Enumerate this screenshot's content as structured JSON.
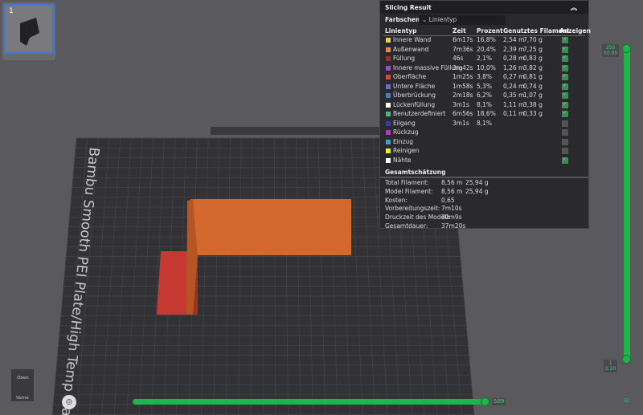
{
  "thumbnail": {
    "index": "1"
  },
  "plate": {
    "label": "Bambu Smooth PEI Plate/High Temp Plate"
  },
  "panel": {
    "title": "Slicing Result",
    "color_scheme_label": "Farbschema",
    "color_scheme_value": "Linientyp",
    "columns": [
      "Linientyp",
      "Zeit",
      "Prozent",
      "Genutztes Filament",
      "Anzeigen"
    ],
    "rows": [
      {
        "name": "Innere Wand",
        "time": "6m17s",
        "pct": "16,8%",
        "len": "2,54 m",
        "wt": "7,70 g",
        "color": "#e8d04a",
        "shown": true
      },
      {
        "name": "Außenwand",
        "time": "7m36s",
        "pct": "20,4%",
        "len": "2,39 m",
        "wt": "7,25 g",
        "color": "#e8894a",
        "shown": true
      },
      {
        "name": "Füllung",
        "time": "46s",
        "pct": "2,1%",
        "len": "0,28 m",
        "wt": "0,83 g",
        "color": "#9a2d2d",
        "shown": true
      },
      {
        "name": "Innere massive Füllung",
        "time": "3m42s",
        "pct": "10,0%",
        "len": "1,26 m",
        "wt": "3,82 g",
        "color": "#9a4ad0",
        "shown": true
      },
      {
        "name": "Oberfläche",
        "time": "1m25s",
        "pct": "3,8%",
        "len": "0,27 m",
        "wt": "0,81 g",
        "color": "#d64a3a",
        "shown": true
      },
      {
        "name": "Untere Fläche",
        "time": "1m58s",
        "pct": "5,3%",
        "len": "0,24 m",
        "wt": "0,74 g",
        "color": "#6a6ad0",
        "shown": true
      },
      {
        "name": "Überbrückung",
        "time": "2m18s",
        "pct": "6,2%",
        "len": "0,35 m",
        "wt": "1,07 g",
        "color": "#4a7ac0",
        "shown": true
      },
      {
        "name": "Lückenfüllung",
        "time": "3m1s",
        "pct": "8,1%",
        "len": "1,11 m",
        "wt": "3,38 g",
        "color": "#ffffff",
        "shown": true
      },
      {
        "name": "Benutzerdefiniert",
        "time": "6m56s",
        "pct": "18,6%",
        "len": "0,11 m",
        "wt": "0,33 g",
        "color": "#4ab87a",
        "shown": true
      },
      {
        "name": "Eilgang",
        "time": "3m1s",
        "pct": "8,1%",
        "len": "",
        "wt": "",
        "color": "#3a3ab0",
        "shown": false
      },
      {
        "name": "Rückzug",
        "time": "",
        "pct": "",
        "len": "",
        "wt": "",
        "color": "#c030c0",
        "shown": false
      },
      {
        "name": "Einzug",
        "time": "",
        "pct": "",
        "len": "",
        "wt": "",
        "color": "#3aa0d0",
        "shown": false
      },
      {
        "name": "Reinigen",
        "time": "",
        "pct": "",
        "len": "",
        "wt": "",
        "color": "#f0f020",
        "shown": false
      },
      {
        "name": "Nähte",
        "time": "",
        "pct": "",
        "len": "",
        "wt": "",
        "color": "#ffffff",
        "shown": true
      }
    ],
    "summary_title": "Gesamtschätzung",
    "summary": [
      {
        "label": "Total Filament:",
        "v1": "8,56 m",
        "v2": "25,94 g"
      },
      {
        "label": "Model Filament:",
        "v1": "8,56 m",
        "v2": "25,94 g"
      },
      {
        "label": "Kosten:",
        "v1": "0,65",
        "v2": ""
      },
      {
        "label": "Vorbereitungszeit:",
        "v1": "7m10s",
        "v2": ""
      },
      {
        "label": "Druckzeit des Modell:",
        "v1": "30m9s",
        "v2": ""
      },
      {
        "label": "Gesamtdauer:",
        "v1": "37m20s",
        "v2": ""
      }
    ]
  },
  "layer_slider": {
    "top_layer": "250",
    "top_height": "50.00",
    "bottom_layer": "1",
    "bottom_height": "0.20"
  },
  "move_slider": {
    "value": "589"
  },
  "view_cube": {
    "top": "Oben",
    "front": "Vorne"
  }
}
